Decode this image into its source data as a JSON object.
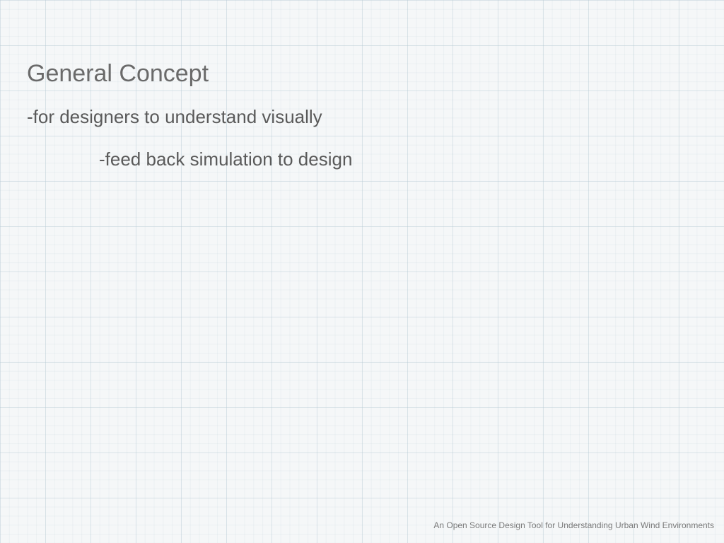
{
  "slide": {
    "title": "General Concept",
    "bullets": {
      "level1": "-for designers to understand visually",
      "level2": "-feed back simulation to design"
    },
    "footer": "An Open Source Design Tool for Understanding Urban Wind Environments"
  }
}
